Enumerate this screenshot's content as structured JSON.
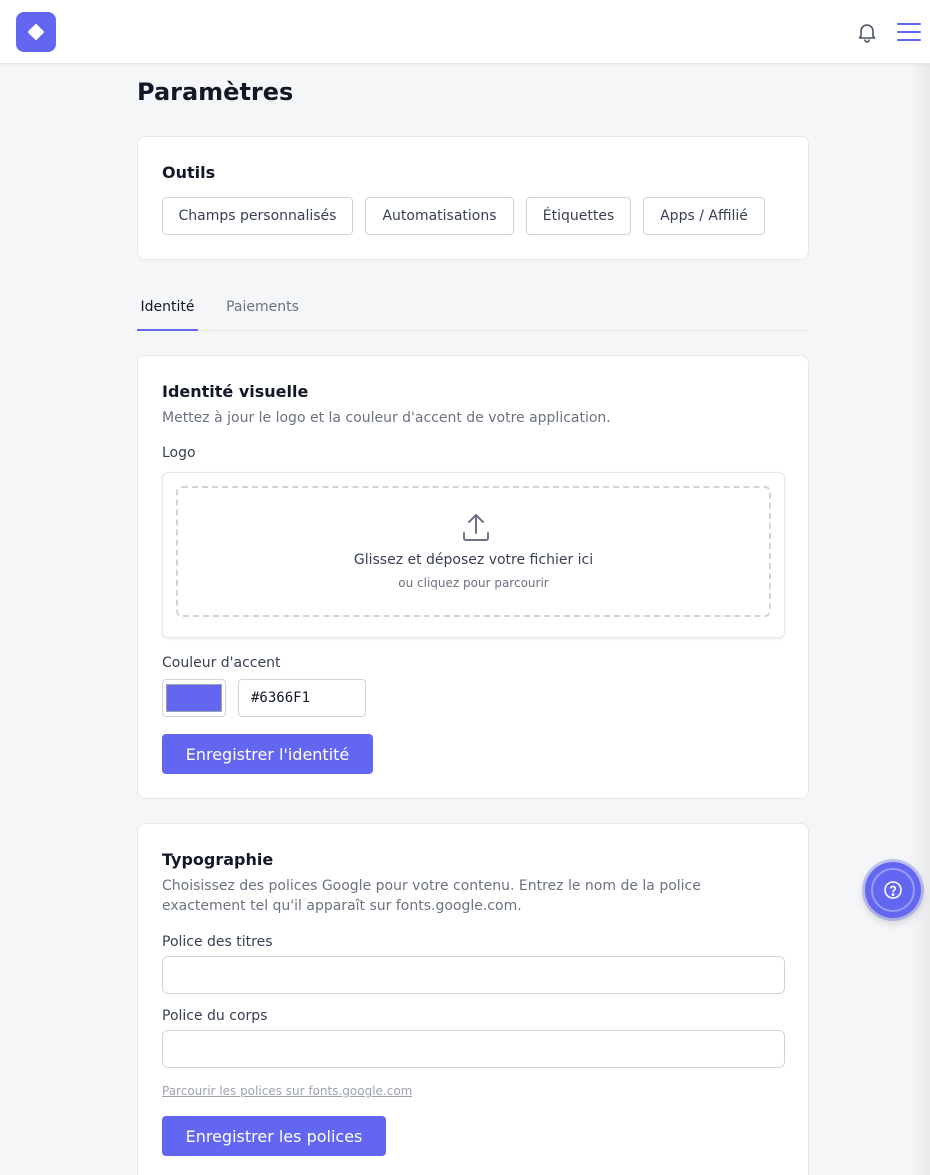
{
  "header": {
    "logo_icon": "diamond-icon",
    "notifications_icon": "bell-icon",
    "menu_icon": "hamburger-menu-icon"
  },
  "page": {
    "title": "Paramètres"
  },
  "tools": {
    "title": "Outils",
    "buttons": [
      {
        "label": "Champs personnalisés"
      },
      {
        "label": "Automatisations"
      },
      {
        "label": "Étiquettes"
      },
      {
        "label": "Apps / Affilié"
      }
    ]
  },
  "tabs": [
    {
      "label": "Identité",
      "active": true
    },
    {
      "label": "Paiements",
      "active": false
    }
  ],
  "identity": {
    "title": "Identité visuelle",
    "description": "Mettez à jour le logo et la couleur d'accent de votre application.",
    "logo_label": "Logo",
    "upload_icon": "upload-icon",
    "dropzone_main": "Glissez et déposez votre fichier ici",
    "dropzone_sub": "ou cliquez pour parcourir",
    "accent_label": "Couleur d'accent",
    "accent_value": "#6366F1",
    "save_label": "Enregistrer l'identité"
  },
  "typography": {
    "title": "Typographie",
    "description": "Choisissez des polices Google pour votre contenu. Entrez le nom de la police exactement tel qu'il apparaît sur fonts.google.com.",
    "heading_font_label": "Police des titres",
    "heading_font_value": "",
    "body_font_label": "Police du corps",
    "body_font_value": "",
    "browse_link": "Parcourir les polices sur fonts.google.com",
    "save_label": "Enregistrer les polices"
  },
  "help": {
    "icon": "help-circle-icon"
  },
  "colors": {
    "accent": "#6366F1",
    "background": "#F5F6F8",
    "card_border": "#E5E7EB",
    "text_primary": "#111827",
    "text_muted": "#6B7280"
  }
}
